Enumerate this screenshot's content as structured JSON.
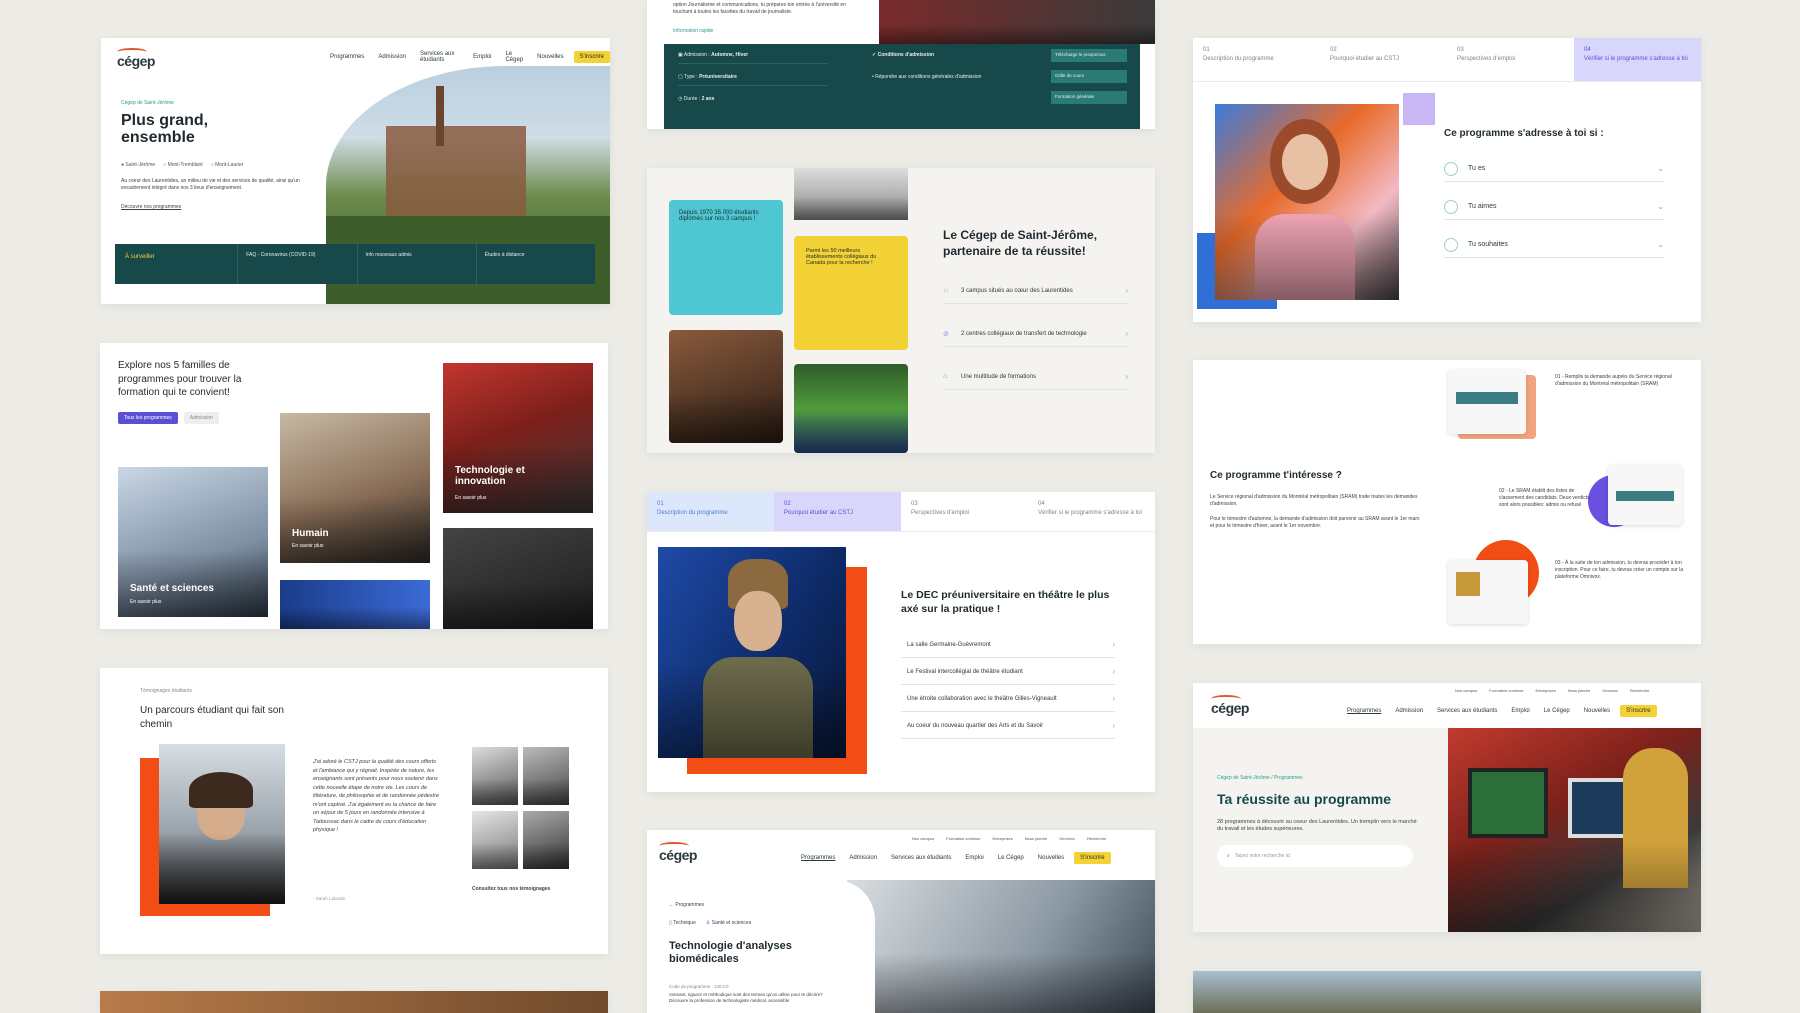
{
  "card1": {
    "nav": [
      "Programmes",
      "Admission",
      "Services aux étudiants",
      "Emploi",
      "Le Cégep",
      "Nouvelles"
    ],
    "nav_cta": "S'inscrire",
    "breadcrumb": "Cégep de Saint-Jérôme",
    "title": "Plus grand, ensemble",
    "campuses": [
      "Saint-Jérôme",
      "Mont-Tremblant",
      "Mont-Laurier"
    ],
    "body": "Au coeur des Laurentides, un milieu de vie et des services de qualité, ainsi qu'un encadrement intégré dans nos 3 lieux d'enseignement.",
    "link": "Découvre nos programmes",
    "bar": [
      "À surveiller",
      "FAQ - Coronavirus (COVID-19)",
      "Info nouveaux admis",
      "Études à distance"
    ]
  },
  "card2": {
    "intro": "option Journalisme et communications, tu prépares ton entrée à l'université en touchant à toutes les facettes du travail de journaliste.",
    "info_label": "Information rapide",
    "rows": [
      {
        "k": "Admission",
        "v": "Automne, Hiver"
      },
      {
        "k": "Type",
        "v": "Préuniversitaire"
      },
      {
        "k": "Durée",
        "v": "2 ans"
      }
    ],
    "conditions_title": "Conditions d'admission",
    "conditions_item": "Répondre aux conditions générales d'admission",
    "buttons": [
      "Télécharge le prospectus",
      "Grille de cours",
      "Formation générale"
    ]
  },
  "card3": {
    "tile_blue": "Depuis 1970 35 000 étudiants diplômés sur nos 3 campus !",
    "tile_yellow": "Parmi les 50 meilleurs établissements collégiaux du Canada pour la recherche !",
    "title": "Le Cégep de Saint-Jérôme, partenaire de ta réussite!",
    "items": [
      "3 campus situés au cœur des Laurentides",
      "2 centres collégiaux de transfert de technologie",
      "Une multitude de formations"
    ]
  },
  "card4": {
    "tabs": [
      "Description du programme",
      "Pourquoi étudier au CSTJ",
      "Perspectives d'emploi",
      "Vérifier si le programme s'adresse à toi"
    ],
    "tab_nums": [
      "01",
      "02",
      "03",
      "04"
    ],
    "title": "Ce programme s'adresse à toi si :",
    "items": [
      "Tu es",
      "Tu aimes",
      "Tu souhaites"
    ]
  },
  "card5": {
    "title": "Explore nos 5 familles de programmes pour trouver la formation qui te convient!",
    "chip_active": "Tous les programmes",
    "chip": "Admission",
    "tiles": [
      "Santé et sciences",
      "Humain",
      "Technologie et innovation"
    ],
    "more": "En savoir plus"
  },
  "card6": {
    "tabs": [
      "Description du programme",
      "Pourquoi étudier au CSTJ",
      "Perspectives d'emploi",
      "Vérifier si le programme s'adresse à toi"
    ],
    "tab_nums": [
      "01",
      "02",
      "03",
      "04"
    ],
    "title": "Le DEC préuniversitaire en théâtre le plus axé sur la pratique !",
    "items": [
      "La salle Germaine-Guèvremont",
      "Le Festival intercollégial de théâtre étudiant",
      "Une étroite collaboration avec le théâtre Gilles-Vigneault",
      "Au coeur du nouveau quartier des Arts et du Savoir"
    ]
  },
  "card7": {
    "title": "Ce programme t'intéresse ?",
    "body1": "Le Service régional d'admission du Montréal métropolitain (SRAM) traite toutes les demandes d'admission.",
    "body2": "Pour le trimestre d'automne, la demande d'admission doit parvenir au SRAM avant le 1er mars et pour le trimestre d'hiver, avant le 1er novembre.",
    "steps": [
      "01 - Remplis ta demande auprès du Service régional d'admission du Montréal métropolitain (SRAM)",
      "02 - Le SRAM établit des listes de classement des candidats. Deux verdicts sont alors possibles: admis ou refusé",
      "03 - À la suite de ton admission, tu devras procéder à ton inscription. Pour ce faire, tu devras créer un compte sur la plateforme Omnivox."
    ]
  },
  "card8": {
    "label": "Témoignages étudiants",
    "title": "Un parcours étudiant qui fait son chemin",
    "quote": "J'ai adoré le CSTJ pour la qualité des cours offerts et l'ambiance qui y régnait. Inspirée de nature, les enseignants sont présents pour nous soutenir dans cette nouvelle étape de notre vie. Les cours de littérature, de philosophie et de randonnée pédestre m'ont captivé. J'ai également eu la chance de faire un séjour de 5 jours en randonnée intensive à Tadoussac dans le cadre du cours d'éducation physique !",
    "author": "- Sarah Lalonde",
    "link": "Consultez tous nos témoignages"
  },
  "card9": {
    "topnav": [
      "Nos campus",
      "Formation continue",
      "Entreprises",
      "Nous joindre",
      "Omnivox",
      "Recherche"
    ],
    "nav": [
      "Programmes",
      "Admission",
      "Services aux étudiants",
      "Emploi",
      "Le Cégep",
      "Nouvelles"
    ],
    "nav_cta": "S'inscrire",
    "back": "Programmes",
    "tags": [
      "Technique",
      "Santé et sciences"
    ],
    "title": "Technologie d'analyses biomédicales",
    "code": "Code du programme : 140.C0",
    "body": "Avenant, rigueur et méthodique sont des termes qu'on utilise pour te décrire? Découvre la profession de technologiste médical, accessible"
  },
  "card10": {
    "topnav": [
      "Nos campus",
      "Formation continue",
      "Entreprises",
      "Nous joindre",
      "Omnivox",
      "Recherche"
    ],
    "nav": [
      "Programmes",
      "Admission",
      "Services aux étudiants",
      "Emploi",
      "Le Cégep",
      "Nouvelles"
    ],
    "nav_cta": "S'inscrire",
    "breadcrumb": "Cégep de Saint-Jérôme / Programmes",
    "title": "Ta réussite au programme",
    "body": "28 programmes à découvrir au coeur des Laurentides. Un tremplin vers le marché du travail et les études supérieures.",
    "search_placeholder": "Tapez votre recherche ici"
  },
  "logo": "cégep",
  "colors": {
    "teal": "#17494a",
    "orange": "#f14d14",
    "yellow": "#f2d234",
    "purple": "#5b4fd6",
    "cyan": "#4fc7d3"
  }
}
